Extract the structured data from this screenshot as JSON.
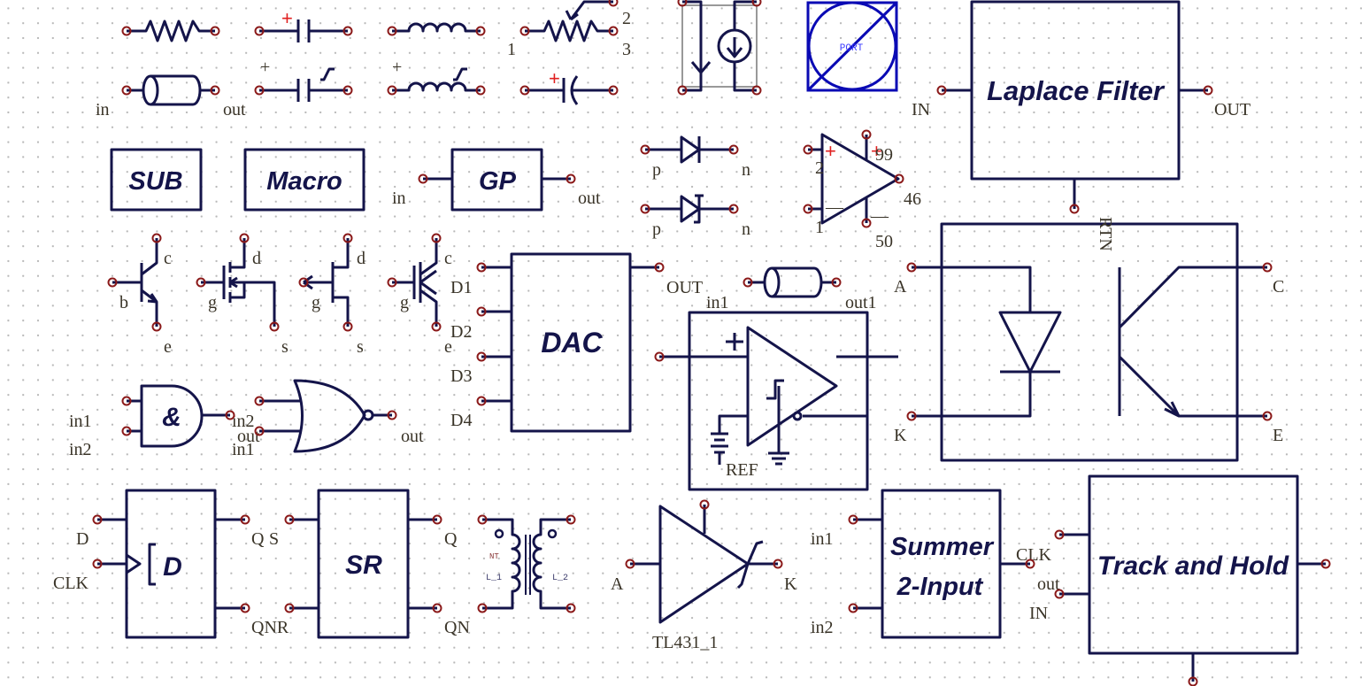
{
  "colors": {
    "wire": "#14144a",
    "pin": "#8b1a1a",
    "port": "#0a0ab4",
    "plus": "#e02020"
  },
  "potentiometer": {
    "p1": "1",
    "p2": "2",
    "p3": "3"
  },
  "plus": "+",
  "coax1": {
    "in": "in",
    "out": "out"
  },
  "port": {
    "label": "PORT"
  },
  "laplace": {
    "title": "Laplace Filter",
    "in": "IN",
    "out": "OUT"
  },
  "sub": {
    "title": "SUB"
  },
  "macro": {
    "title": "Macro"
  },
  "gp": {
    "title": "GP",
    "in": "in",
    "out": "out"
  },
  "diode": {
    "p": "p",
    "n": "n"
  },
  "zener": {
    "p": "p",
    "n": "n"
  },
  "opamp": {
    "in_plus": "2",
    "in_minus": "1",
    "vplus": "99",
    "out": "46",
    "vminus": "50",
    "minus": "—"
  },
  "optocoupler": {
    "rtn": "RTN",
    "a": "A",
    "k": "K",
    "c": "C",
    "e": "E"
  },
  "bjt": {
    "b": "b",
    "c": "c",
    "e": "e"
  },
  "mosfet": {
    "g": "g",
    "d": "d",
    "s": "s"
  },
  "jfet": {
    "g": "g",
    "d": "d",
    "s": "s"
  },
  "igbt": {
    "g": "g",
    "c": "c",
    "e": "e"
  },
  "dac": {
    "title": "DAC",
    "d1": "D1",
    "d2": "D2",
    "d3": "D3",
    "d4": "D4",
    "out": "OUT"
  },
  "coax2": {
    "in": "in1",
    "out": "out1"
  },
  "comparator": {
    "ref": "REF"
  },
  "and_gate": {
    "symbol": "&",
    "in1": "in1",
    "in2": "in2"
  },
  "or_gate": {
    "in2": "in2",
    "out_overlap": "out",
    "in1": "in1",
    "out": "out"
  },
  "dff": {
    "symbol": "D",
    "d": "D",
    "clk": "CLK",
    "q": "Q",
    "qnr": "QNR"
  },
  "sr": {
    "title": "SR",
    "s": "S",
    "q": "Q",
    "qn": "QN"
  },
  "transformer": {
    "nt": "NT",
    "l1": "L_1",
    "l2": "L_2"
  },
  "tl431": {
    "a": "A",
    "k": "K",
    "name": "TL431_1"
  },
  "summer": {
    "line1": "Summer",
    "line2": "2-Input",
    "in1": "in1",
    "in2": "in2"
  },
  "track_hold": {
    "title": "Track and Hold",
    "clk": "CLK",
    "out": "out",
    "in": "IN"
  }
}
